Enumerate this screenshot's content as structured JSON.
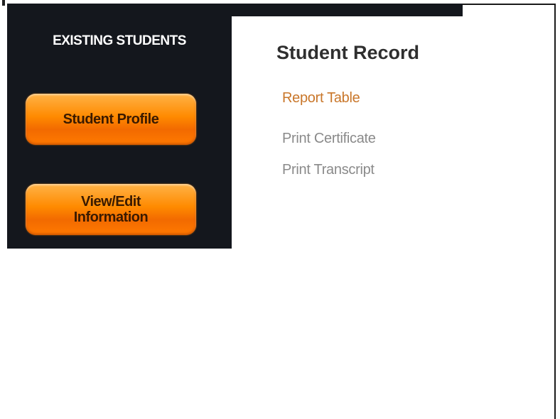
{
  "sidebar": {
    "title": "EXISTING STUDENTS",
    "buttons": [
      {
        "label": "Student Profile"
      },
      {
        "label_line1": "View/Edit",
        "label_line2": "Information"
      }
    ]
  },
  "main": {
    "title": "Student Record",
    "links": [
      {
        "label": "Report Table",
        "color": "#c9772b"
      },
      {
        "label": "Print Certificate",
        "color": "#8a8a8a"
      },
      {
        "label": "Print Transcript",
        "color": "#8a8a8a"
      }
    ]
  },
  "colors": {
    "sidebar_bg": "#14171d",
    "button_orange": "#ff8a00",
    "active_link": "#c9772b",
    "inactive_link": "#8a8a8a"
  }
}
